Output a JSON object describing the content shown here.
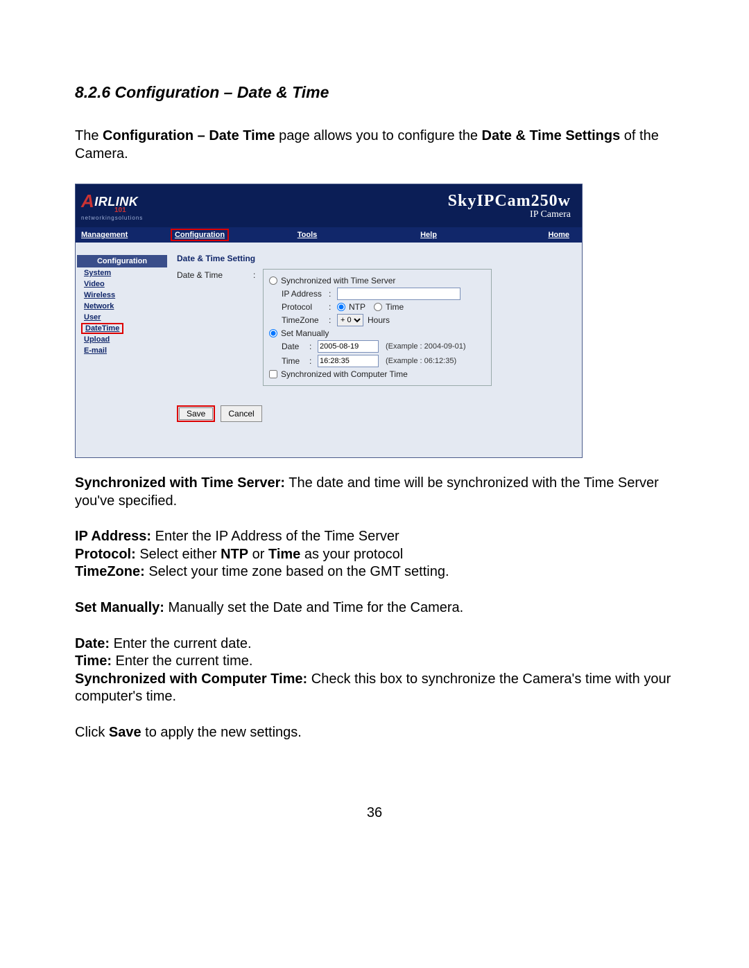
{
  "doc": {
    "section_title": "8.2.6 Configuration – Date & Time",
    "intro_pre": "The ",
    "intro_b1": "Configuration – Date Time",
    "intro_mid": " page allows you to configure the ",
    "intro_b2": "Date & Time Settings",
    "intro_post": " of the Camera.",
    "page_number": "36"
  },
  "ui": {
    "logo": {
      "brand_a": "A",
      "brand_rest": "IRLINK",
      "num": "101",
      "tagline": "networkingsolutions"
    },
    "product": {
      "name": "SkyIPCam250w",
      "sub": "IP Camera"
    },
    "nav": {
      "management": "Management",
      "configuration": "Configuration",
      "tools": "Tools",
      "help": "Help",
      "home": "Home"
    },
    "sidebar": {
      "header": "Configuration",
      "items": [
        "System",
        "Video",
        "Wireless",
        "Network",
        "User",
        "DateTime",
        "Upload",
        "E-mail"
      ]
    },
    "panel": {
      "title": "Date & Time Setting",
      "row_label": "Date & Time",
      "opt_sync_server": "Synchronized with Time Server",
      "ip_label": "IP Address",
      "ip_value": "",
      "proto_label": "Protocol",
      "proto_ntp": "NTP",
      "proto_time": "Time",
      "tz_label": "TimeZone",
      "tz_value": "+ 0",
      "tz_suffix": "Hours",
      "opt_manual": "Set Manually",
      "date_label": "Date",
      "date_value": "2005-08-19",
      "date_example": "(Example : 2004-09-01)",
      "time_label": "Time",
      "time_value": "16:28:35",
      "time_example": "(Example : 06:12:35)",
      "sync_pc": "Synchronized with Computer Time",
      "save": "Save",
      "cancel": "Cancel"
    }
  },
  "explain": {
    "sync_b": "Synchronized with Time Server:",
    "sync_t": " The date and time will be synchronized with the Time Server you've specified.",
    "ip_b": "IP Address:",
    "ip_t": " Enter the IP Address of the Time Server",
    "proto_b": "Protocol:",
    "proto_t1": " Select either ",
    "proto_ntp": "NTP",
    "proto_t2": " or ",
    "proto_time": "Time",
    "proto_t3": " as your protocol",
    "tz_b": "TimeZone:",
    "tz_t": " Select your time zone based on the GMT setting.",
    "setman_b": "Set Manually:",
    "setman_t": " Manually set the Date and Time for the Camera.",
    "date_b": "Date:",
    "date_t": " Enter the current date.",
    "time_b": "Time:",
    "time_t": " Enter the current time.",
    "syncpc_b": "Synchronized with Computer Time:",
    "syncpc_t": " Check this box to synchronize the Camera's time with your computer's time.",
    "save_pre": "Click ",
    "save_b": "Save",
    "save_post": " to apply the new settings."
  }
}
